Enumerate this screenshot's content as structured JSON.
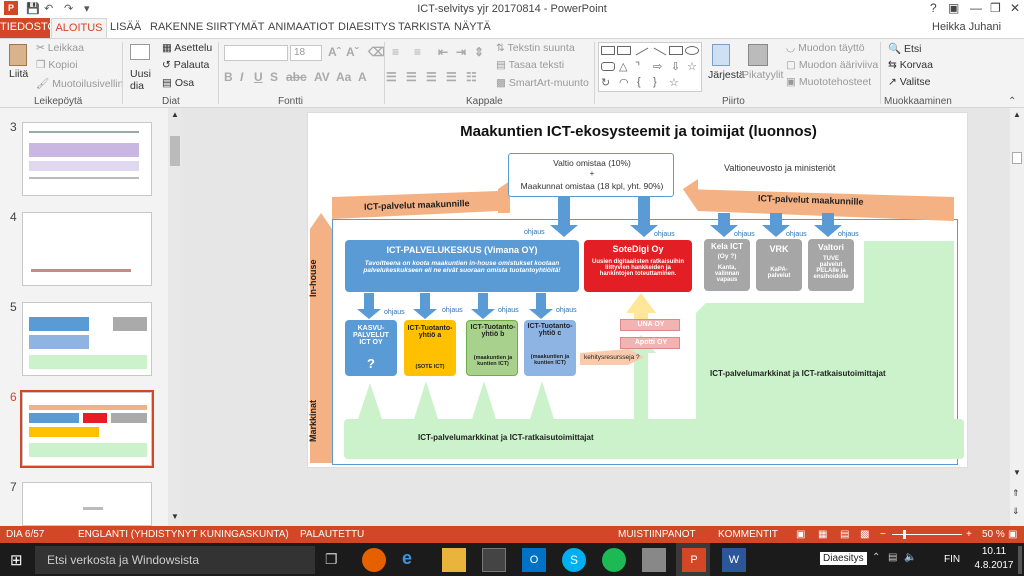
{
  "window": {
    "title": "ICT-selvitys yjr 20170814 - PowerPoint",
    "user": "Heikka Juhani",
    "help": "?"
  },
  "tabs": [
    "TIEDOSTO",
    "ALOITUS",
    "LISÄÄ",
    "RAKENNE",
    "SIIRTYMÄT",
    "ANIMAATIOT",
    "DIAESITYS",
    "TARKISTA",
    "NÄYTÄ"
  ],
  "ribbon": {
    "clipboard": {
      "paste": "Liitä",
      "cut": "Leikkaa",
      "copy": "Kopioi",
      "format_painter": "Muotoilusivellin",
      "label": "Leikepöytä"
    },
    "slides": {
      "new": "Uusi",
      "new2": "dia",
      "layout": "Asettelu",
      "reset": "Palauta",
      "section": "Osa",
      "label": "Diat"
    },
    "font": {
      "size": "18",
      "label": "Fontti"
    },
    "paragraph": {
      "direction": "Tekstin suunta",
      "align": "Tasaa teksti",
      "smartart": "SmartArt-muunto",
      "label": "Kappale"
    },
    "drawing": {
      "arrange": "Järjestä",
      "quick_styles": "Pikatyylit",
      "fill": "Muodon täyttö",
      "outline": "Muodon ääriviiva",
      "effects": "Muototehosteet",
      "label": "Piirto"
    },
    "editing": {
      "find": "Etsi",
      "replace": "Korvaa",
      "select": "Valitse",
      "label": "Muokkaaminen"
    }
  },
  "thumbnails": [
    {
      "num": "3"
    },
    {
      "num": "4"
    },
    {
      "num": "5"
    },
    {
      "num": "6"
    },
    {
      "num": "7"
    }
  ],
  "slide": {
    "title": "Maakuntien ICT-ekosysteemit ja toimijat (luonnos)",
    "owners_line1": "Valtio omistaa (10%)",
    "owners_plus": "+",
    "owners_line2": "Maakunnat omistaa (18 kpl, yht. 90%)",
    "ministry": "Valtioneuvosto ja ministeriöt",
    "arrow_left": "ICT-palvelut maakunnille",
    "arrow_right": "ICT-palvelut maakunnille",
    "inhouse": "In-house",
    "markkinat": "Markkinat",
    "ohjaus": "ohjaus",
    "center_title": "ICT-PALVELUKESKUS (Vimana OY)",
    "center_desc": "Tavoitteena on koota maakuntien in-house omistukset kootaan palvelukeskukseen eli ne eivät suoraan omista tuotantoyhtiöitä!",
    "sotedigi_title": "SoteDigi Oy",
    "sotedigi_desc": "Uusien digitaalisten ratkaisuihin liittyvien hankkeiden ja hankintojen toteuttaminen.",
    "kela_title": "Kela ICT",
    "kela_sub": "(Oy ?)",
    "kela_desc": "Kanta, valinnan vapaus",
    "vrk_title": "VRK",
    "vrk_desc": "KaPA-palvelut",
    "valtori_title": "Valtori",
    "valtori_desc": "TUVE palvelut PELAlle ja ensihoidolle",
    "kasvu": "KASVU-PALVELUT ICT OY",
    "kasvu_q": "?",
    "prod_a": "ICT-Tuotanto-yhtiö a",
    "prod_a_sub": "(SOTE ICT)",
    "prod_b": "ICT-Tuotanto-yhtiö b",
    "prod_b_sub": "(maakuntien ja kuntien ICT)",
    "prod_c": "ICT-Tuotanto-yhtiö c",
    "prod_c_sub": "(maakuntien ja kuntien ICT)",
    "una": "UNA OY",
    "apotti": "Apotti OY",
    "kehitys": "kehitysresursseja ?",
    "market_right": "ICT-palvelumarkkinat ja ICT-ratkaisutoimittajat",
    "market_bottom": "ICT-palvelumarkkinat ja ICT-ratkaisutoimittajat"
  },
  "status": {
    "slide": "DIA 6/57",
    "lang": "ENGLANTI (YHDISTYNYT KUNINGASKUNTA)",
    "restored": "PALAUTETTU",
    "notes": "MUISTIINPANOT",
    "comments": "KOMMENTIT",
    "zoom": "50 %"
  },
  "taskbar": {
    "search": "Etsi verkosta ja Windowsista",
    "diaesitys": "Diaesitys",
    "lang": "FIN",
    "time": "10.11",
    "date": "4.8.2017"
  },
  "colors": {
    "accent": "#d24726",
    "blue": "#5b9bd5",
    "red": "#e31e24",
    "green": "#ccf2cc",
    "salmon": "#f4b183"
  }
}
